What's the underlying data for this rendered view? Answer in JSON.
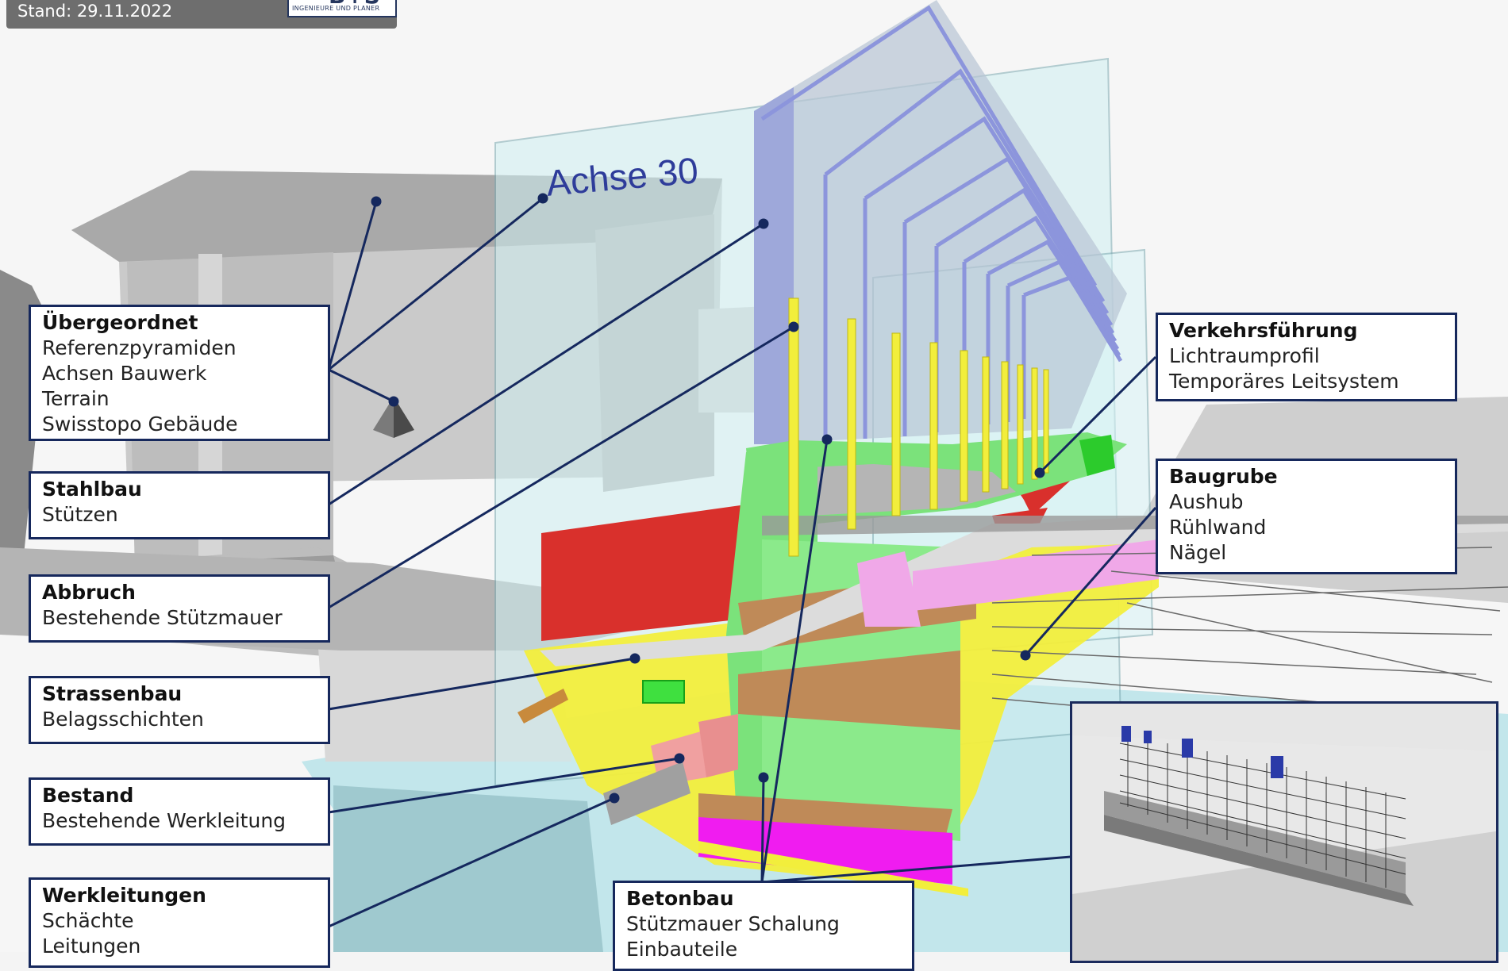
{
  "header": {
    "date": "Stand: 29.11.2022",
    "logo_mark": "B+S",
    "logo_text": "INGENIEURE UND PLANER"
  },
  "axis_label": "Achse 30",
  "callouts": {
    "uebergeordnet": {
      "title": "Übergeordnet",
      "items": [
        "Referenzpyramiden",
        "Achsen Bauwerk",
        "Terrain",
        "Swisstopo Gebäude"
      ]
    },
    "stahlbau": {
      "title": "Stahlbau",
      "items": [
        "Stützen"
      ]
    },
    "abbruch": {
      "title": "Abbruch",
      "items": [
        "Bestehende Stützmauer"
      ]
    },
    "strassenbau": {
      "title": "Strassenbau",
      "items": [
        "Belagsschichten"
      ]
    },
    "bestand": {
      "title": "Bestand",
      "items": [
        "Bestehende Werkleitung"
      ]
    },
    "werkleitungen": {
      "title": "Werkleitungen",
      "items": [
        "Schächte",
        "Leitungen"
      ]
    },
    "verkehrsfuehrung": {
      "title": "Verkehrsführung",
      "items": [
        "Lichtraumprofil",
        "Temporäres Leitsystem"
      ]
    },
    "baugrube": {
      "title": "Baugrube",
      "items": [
        "Aushub",
        "Rühlwand",
        "Nägel"
      ]
    },
    "betonbau": {
      "title": "Betonbau",
      "items": [
        "Stützmauer Schalung",
        "Einbauteile"
      ]
    }
  },
  "colors": {
    "leader_line": "#15285e",
    "callout_border": "#16285c",
    "steel": "#f2ee3c",
    "concrete": "#7be27b",
    "demolition": "#d9302c",
    "utility": "#f0a8e8",
    "soil": "#bf8a58",
    "magenta": "#f01cf0",
    "glass_plane": "#bfe8ea"
  },
  "icons": {
    "reference_pyramid": "pyramid-icon"
  }
}
